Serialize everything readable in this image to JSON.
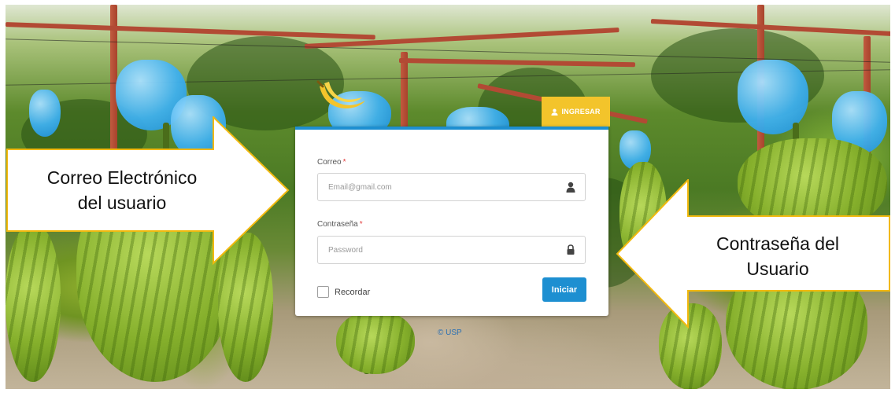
{
  "login": {
    "tab_label": "INGRESAR",
    "email_label": "Correo",
    "email_required": "*",
    "email_placeholder": "Email@gmail.com",
    "password_label": "Contraseña",
    "password_required": "*",
    "password_placeholder": "Password",
    "remember_label": "Recordar",
    "remember_checked": false,
    "submit_label": "Iniciar",
    "footer_text": "© USP"
  },
  "annotations": {
    "left_line1": "Correo Electrónico",
    "left_line2": "del usuario",
    "right_line1": "Contraseña del",
    "right_line2": "Usuario"
  },
  "colors": {
    "accent_blue": "#1d8fd1",
    "tab_yellow": "#f3c42b",
    "callout_border": "#f2b90f",
    "required_red": "#e23b3b"
  },
  "icons": {
    "tab": "user-icon",
    "email": "user-icon",
    "password": "lock-icon",
    "logo": "banana-logo"
  }
}
